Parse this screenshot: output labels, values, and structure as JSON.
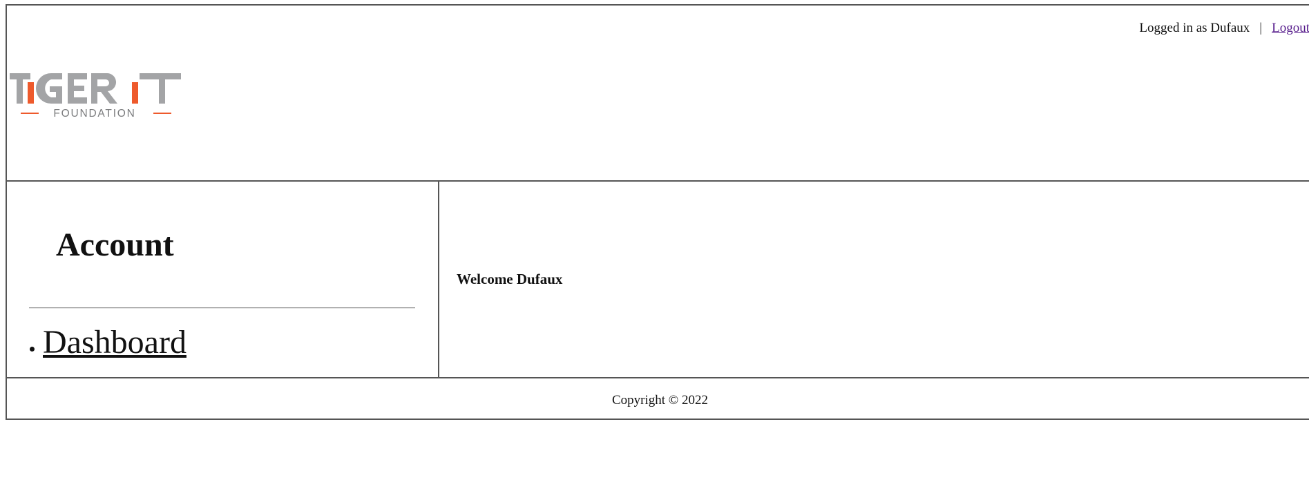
{
  "header": {
    "logged_in_text": "Logged in as Dufaux",
    "separator": "|",
    "logout_label": "Logout",
    "logo": {
      "word": "TiGER iT",
      "sub": "FOUNDATION",
      "gray_color": "#a3a4a6",
      "accent_color": "#ee5a2c"
    }
  },
  "sidebar": {
    "title": "Account",
    "items": [
      {
        "label": "Dashboard"
      }
    ]
  },
  "main": {
    "welcome": "Welcome Dufaux"
  },
  "footer": {
    "copyright": "Copyright © 2022"
  }
}
